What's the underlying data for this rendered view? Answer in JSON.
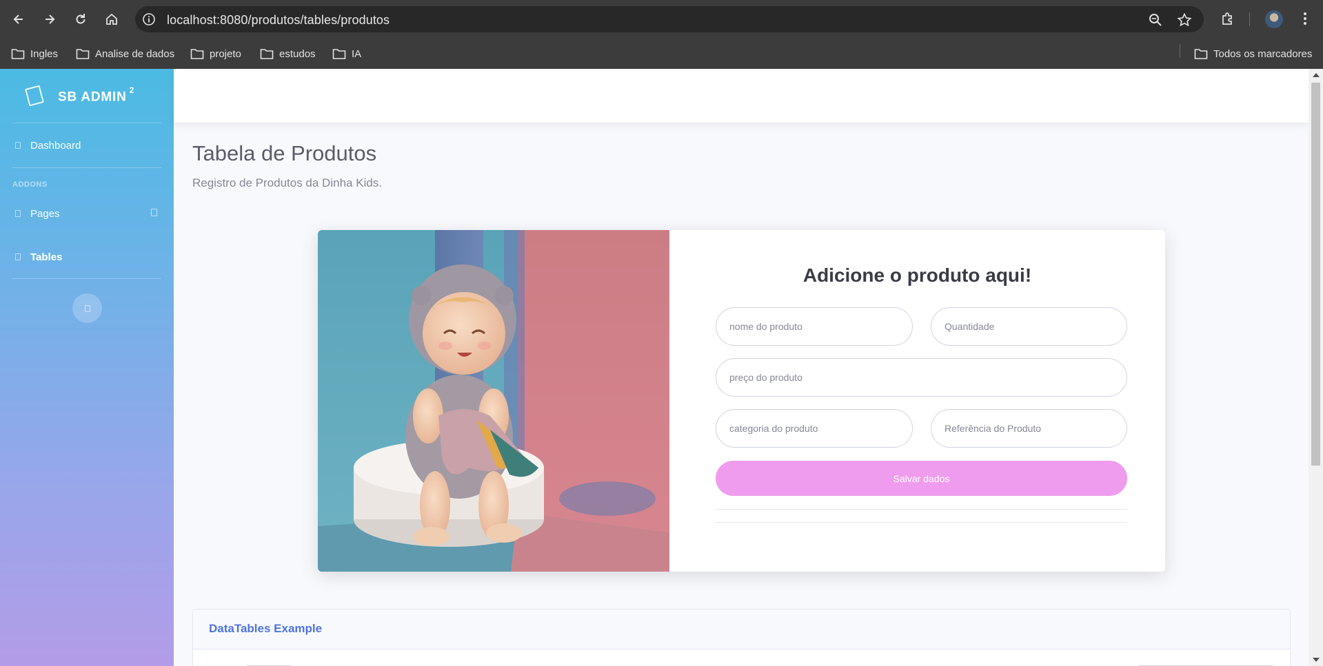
{
  "browser": {
    "url_host": "localhost",
    "url_rest": ":8080/produtos/tables/produtos",
    "icons": [
      "back-icon",
      "forward-icon",
      "reload-icon",
      "home-icon",
      "site-info-icon",
      "zoom-icon",
      "bookmark-star-icon",
      "extensions-icon",
      "profile-avatar",
      "menu-kebab-icon"
    ],
    "bookmarks": [
      "Ingles",
      "Analise de dados",
      "projeto",
      "estudos",
      "IA"
    ],
    "all_bookmarks": "Todos os marcadores"
  },
  "sidebar": {
    "brand": "SB ADMIN",
    "brand_sup": "2",
    "items": [
      {
        "label": "Dashboard"
      },
      {
        "label": "Pages"
      },
      {
        "label": "Tables"
      }
    ],
    "heading": "ADDONS",
    "colors": {
      "top": "#4bbbe3",
      "bottom": "#b39ce8"
    }
  },
  "page": {
    "title": "Tabela de Produtos",
    "subtitle": "Registro de Produtos da Dinha Kids."
  },
  "form": {
    "title": "Adicione o produto aqui!",
    "fields": {
      "nome": "nome do produto",
      "quantidade": "Quantidade",
      "preco": "preço do produto",
      "categoria": "categoria do produto",
      "referencia": "Referência do Produto"
    },
    "save_label": "Salvar dados",
    "save_color": "#f09cee"
  },
  "datatable": {
    "title": "DataTables Example",
    "title_color": "#4e73df"
  }
}
